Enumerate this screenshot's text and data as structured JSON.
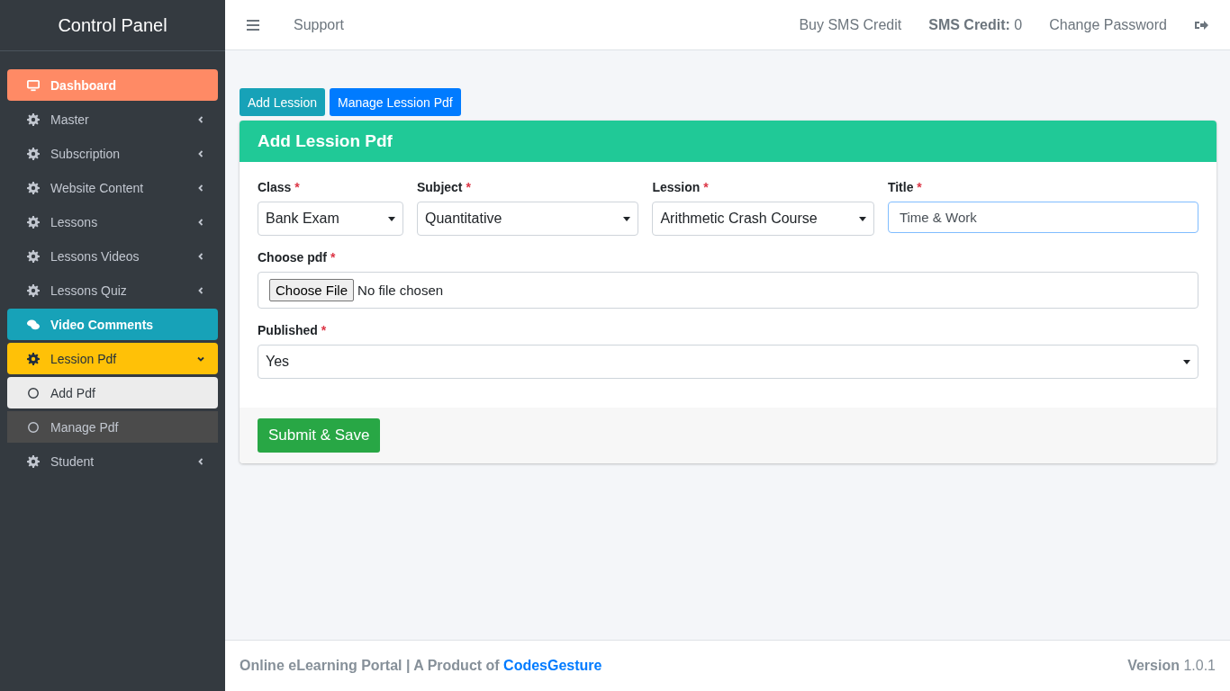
{
  "sidebar": {
    "brand": "Control Panel",
    "items": [
      {
        "kind": "home",
        "label": "Dashboard",
        "color": "#ff8a65"
      },
      {
        "kind": "group",
        "label": "Master",
        "expanded": false
      },
      {
        "kind": "group",
        "label": "Subscription",
        "expanded": false
      },
      {
        "kind": "group",
        "label": "Website Content",
        "expanded": false
      },
      {
        "kind": "group",
        "label": "Lessons",
        "expanded": false
      },
      {
        "kind": "group",
        "label": "Lessons Videos",
        "expanded": false
      },
      {
        "kind": "group",
        "label": "Lessons Quiz",
        "expanded": false
      },
      {
        "kind": "discussion",
        "label": "Video Comments",
        "color": "#17a2b8"
      },
      {
        "kind": "group",
        "label": "Lession Pdf",
        "color": "#ffc107",
        "expanded": true,
        "children": [
          {
            "label": "Add Pdf",
            "selected": true
          },
          {
            "label": "Manage Pdf",
            "selected": false
          }
        ]
      },
      {
        "kind": "group",
        "label": "Student",
        "expanded": false
      }
    ]
  },
  "topbar": {
    "left": [
      "Support"
    ],
    "buy": "Buy SMS Credit",
    "credit_label": "SMS Credit:",
    "credit_value": "0",
    "change_password": "Change Password"
  },
  "actions": [
    {
      "label": "Add Lession",
      "color": "#17a2b8"
    },
    {
      "label": "Manage Lession Pdf",
      "color": "#007bff"
    }
  ],
  "card": {
    "title": "Add Lession Pdf",
    "rows": [
      [
        {
          "kind": "select",
          "label": "Class",
          "required": "*",
          "value": "Bank Exam"
        },
        {
          "kind": "select",
          "label": "Subject",
          "required": "*",
          "value": "Quantitative"
        },
        {
          "kind": "select",
          "label": "Lession",
          "required": "*",
          "value": "Arithmetic Crash Course"
        },
        {
          "kind": "text",
          "label": "Title",
          "required": "*",
          "value": "Time & Work",
          "focused": true
        }
      ],
      [
        {
          "kind": "file",
          "label": "Choose pdf",
          "required": "*",
          "button": "Choose File",
          "status": "No file chosen"
        }
      ],
      [
        {
          "kind": "select",
          "label": "Published",
          "required": "*",
          "value": "Yes"
        }
      ]
    ],
    "submit": "Submit & Save"
  },
  "footer": {
    "text": "Online eLearning Portal | A Product of",
    "link": "CodesGesture",
    "version_label": "Version",
    "version": "1.0.1"
  }
}
